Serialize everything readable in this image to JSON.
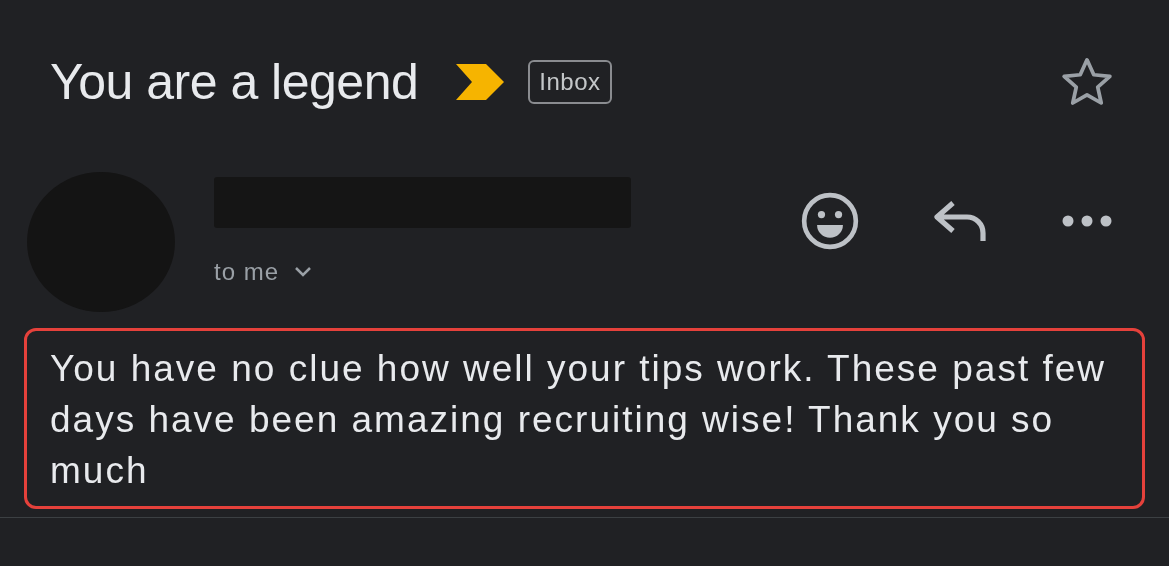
{
  "subject": "You are a legend",
  "important": true,
  "label": "Inbox",
  "starred": false,
  "sender": {
    "name_redacted": true
  },
  "recipient": "to me",
  "body": {
    "text": "You have no clue how well your tips work. These past few days have been amazing recruiting wise! Thank you so much",
    "highlighted": true
  }
}
